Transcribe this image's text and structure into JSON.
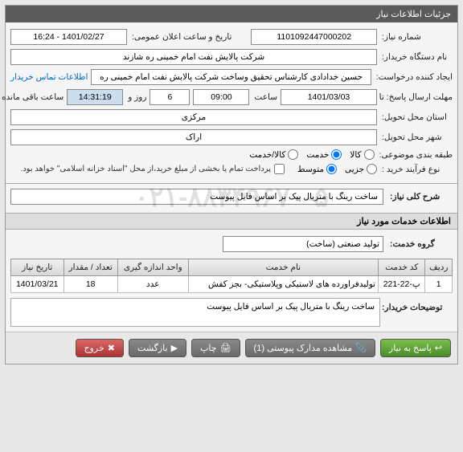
{
  "panel_title": "جزئیات اطلاعات نیاز",
  "fields": {
    "need_no_label": "شماره نیاز:",
    "need_no": "1101092447000202",
    "announce_label": "تاریخ و ساعت اعلان عمومی:",
    "announce_value": "1401/02/27 - 16:24",
    "buyer_org_label": "نام دستگاه خریدار:",
    "buyer_org": "شرکت پالایش نفت امام خمینی ره شازند",
    "creator_label": "ایجاد کننده درخواست:",
    "creator": "حسین خدادادی کارشناس تحقیق وساخت شرکت پالایش نفت امام خمینی ره",
    "contact_link": "اطلاعات تماس خریدار",
    "deadline_label": "مهلت ارسال پاسخ: تا تاریخ:",
    "deadline_date": "1401/03/03",
    "time_label": "ساعت",
    "deadline_time": "09:00",
    "days_and": "روز و",
    "days_left": "6",
    "time_left": "14:31:19",
    "time_remaining_label": "ساعت باقی مانده",
    "delivery_prov_label": "استان محل تحویل:",
    "delivery_prov": "مرکزی",
    "delivery_city_label": "شهر محل تحویل:",
    "delivery_city": "اراک",
    "subject_class_label": "طبقه بندی موضوعی:",
    "goods": "کالا",
    "service": "خدمت",
    "both": "کالا/خدمت",
    "process_label": "نوع فرآیند خرید :",
    "small": "جزیی",
    "medium": "متوسط",
    "payment_note": "پرداخت تمام یا بخشی از مبلغ خرید،از محل \"اسناد خزانه اسلامی\" خواهد بود.",
    "main_desc_label": "شرح کلی نیاز:",
    "main_desc": "ساخت رینگ با متریال پیک بر اساس فایل پیوست",
    "services_info_header": "اطلاعات خدمات مورد نیاز",
    "service_group_label": "گروه خدمت:",
    "service_group": "تولید صنعتی (ساخت)",
    "buyer_notes_label": "توضیحات خریدار:",
    "buyer_notes": "ساخت رینگ با متریال پیک بر اساس فایل پیوست"
  },
  "table": {
    "headers": [
      "ردیف",
      "کد خدمت",
      "نام خدمت",
      "واحد اندازه گیری",
      "تعداد / مقدار",
      "تاریخ نیاز"
    ],
    "rows": [
      [
        "1",
        "پ-22-221",
        "تولیدفراورده های لاستیکی وپلاستیکی- بجز کفش",
        "عدد",
        "18",
        "1401/03/21"
      ]
    ]
  },
  "buttons": {
    "respond": "پاسخ به نیاز",
    "attachments": "مشاهده مدارک پیوستی (1)",
    "print": "چاپ",
    "back": "بازگشت",
    "exit": "خروج"
  },
  "watermark": "۰۲۱-۸۸۳۴۹۶۷۰-۵"
}
